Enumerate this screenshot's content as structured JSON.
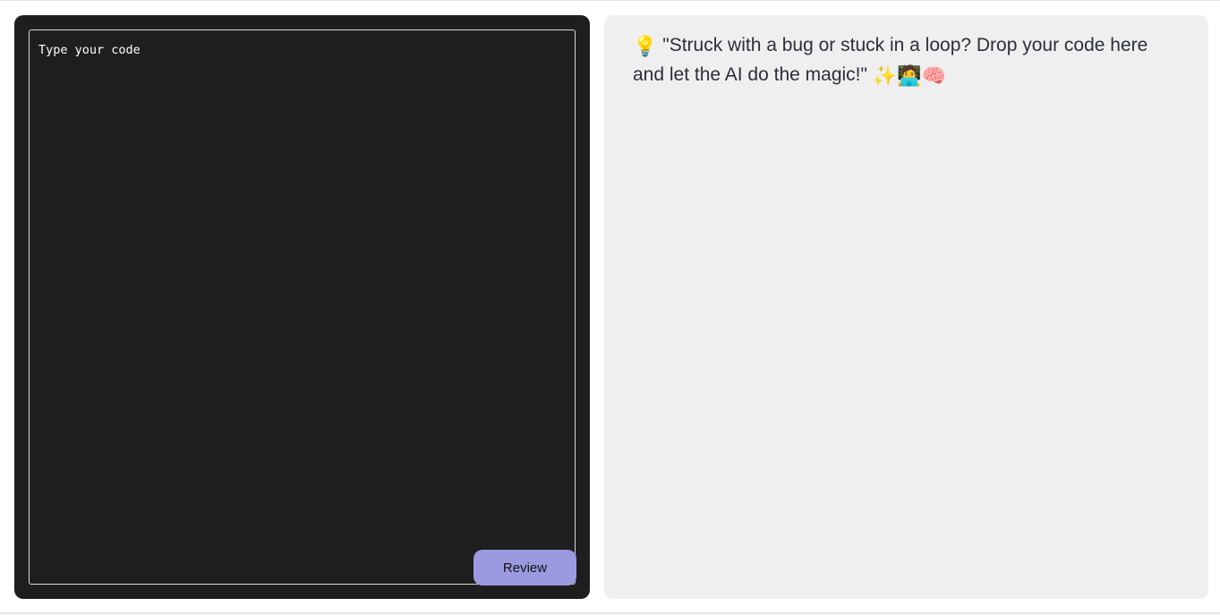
{
  "editor": {
    "placeholder": "Type your code",
    "value": "",
    "review_label": "Review",
    "background_color": "#1e1e1e",
    "button_color": "#9b9ae0"
  },
  "output": {
    "bulb_emoji": "💡",
    "prompt": "\"Struck with a bug or stuck in a loop? Drop your code here and let the AI do the magic!\"",
    "sparkles_emoji": "✨",
    "technologist_emoji": "🧑‍💻",
    "brain_emoji": "🧠",
    "background_color": "#efefef",
    "text_color": "#2b2f3a"
  }
}
